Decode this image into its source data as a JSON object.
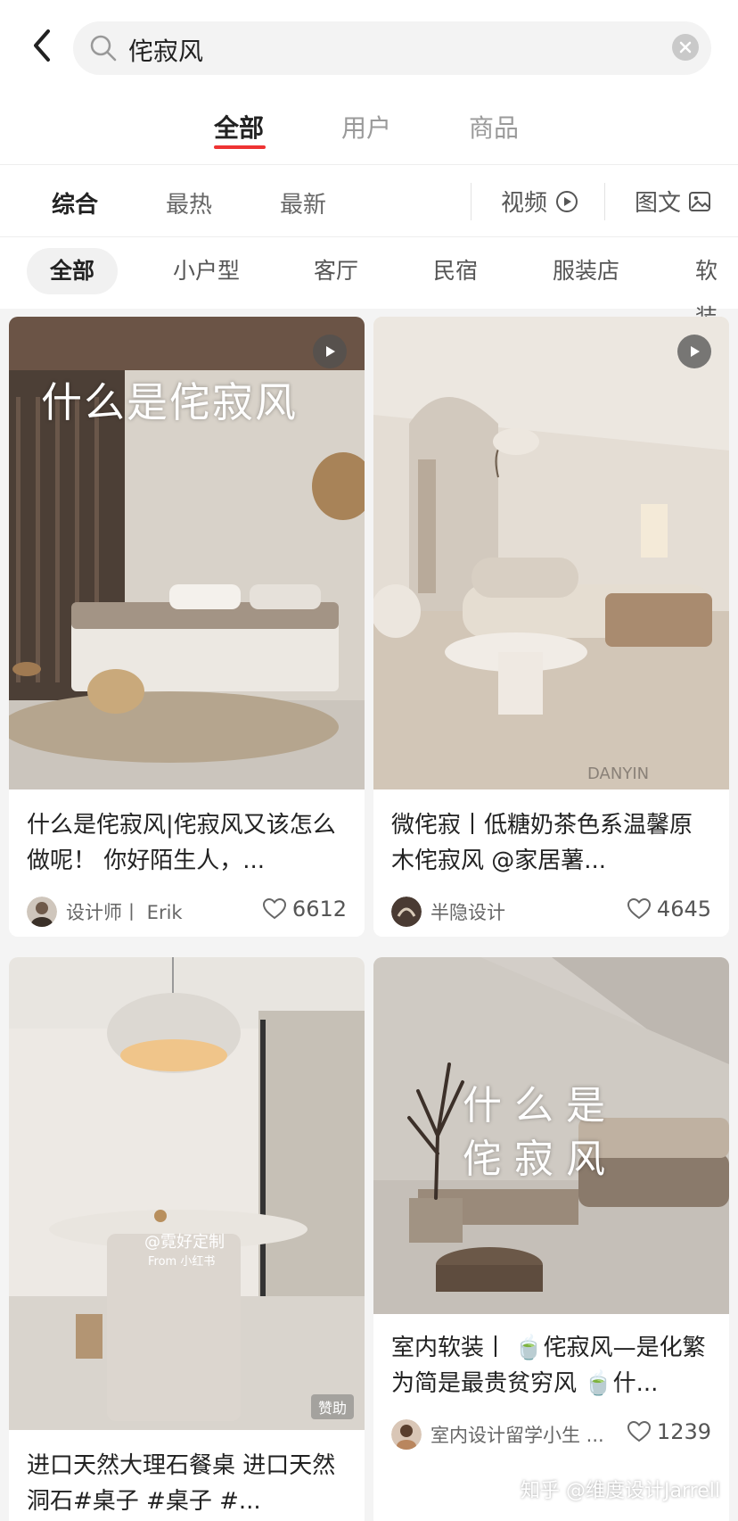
{
  "search": {
    "query": "侘寂风"
  },
  "tabs": [
    {
      "label": "全部",
      "active": true
    },
    {
      "label": "用户",
      "active": false
    },
    {
      "label": "商品",
      "active": false
    }
  ],
  "sort": {
    "items": [
      "综合",
      "最热",
      "最新"
    ],
    "video_label": "视频",
    "image_text_label": "图文"
  },
  "chips": [
    "全部",
    "小户型",
    "客厅",
    "民宿",
    "服装店",
    "软装"
  ],
  "cards": [
    {
      "overlay": "什么是侘寂风",
      "title": "什么是侘寂风|侘寂风又该怎么做呢！ 你好陌生人，...",
      "author": "设计师丨 Erik",
      "likes": "6612",
      "is_video": true
    },
    {
      "watermark": "DANYIN",
      "title": "微侘寂丨低糖奶茶色系温馨原木侘寂风 @家居薯...",
      "author": "半隐设计",
      "likes": "4645",
      "is_video": true
    },
    {
      "image_watermark": "@霓好定制",
      "image_watermark_sub": "From 小红书",
      "ad_tag": "赞助",
      "title": "进口天然大理石餐桌 进口天然洞石#桌子 #桌子 #..."
    },
    {
      "overlay_line1": "什 么 是",
      "overlay_line2": "侘 寂 风",
      "title": "室内软装丨 🍵侘寂风—是化繁为简是最贵贫穷风 🍵什...",
      "author": "室内设计留学小生 ...",
      "likes": "1239"
    }
  ],
  "page_watermark": "知乎 @维度设计Jarrell",
  "colors": {
    "accent": "#e33333",
    "background": "#f4f4f4"
  }
}
